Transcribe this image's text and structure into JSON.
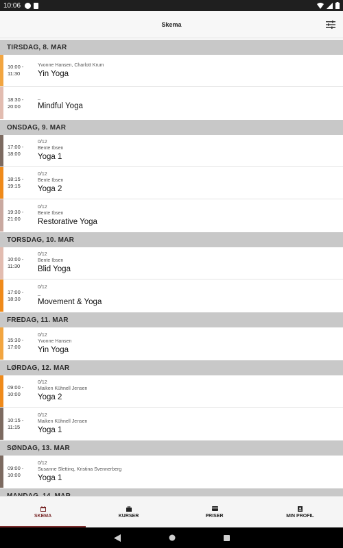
{
  "status_bar": {
    "time": "10:06"
  },
  "app_bar": {
    "title": "Skema",
    "filter_icon": "sliders-icon"
  },
  "colors": {
    "yellow": "#f2a540",
    "pink": "#e2bcb0",
    "brown": "#7c6a60",
    "orange": "#ef8a1a",
    "header": "#c8c8c8",
    "accent": "#7a2a2a"
  },
  "days": [
    {
      "header": "TIRSDAG, 8. MAR",
      "classes": [
        {
          "time_start": "10:00 -",
          "time_end": "11:30",
          "capacity": "",
          "teacher": "Yvonne Hansen, Charlott Krum",
          "name": "Yin Yoga",
          "color": "#f2a540"
        },
        {
          "time_start": "18:30 -",
          "time_end": "20:00",
          "capacity": "",
          "teacher": "_",
          "name": "Mindful Yoga",
          "color": "#e2bcb0"
        }
      ]
    },
    {
      "header": "ONSDAG, 9. MAR",
      "classes": [
        {
          "time_start": "17:00 -",
          "time_end": "18:00",
          "capacity": "0/12",
          "teacher": "Bente Ibsen",
          "name": "Yoga 1",
          "color": "#7c6a60"
        },
        {
          "time_start": "18:15 -",
          "time_end": "19:15",
          "capacity": "0/12",
          "teacher": "Bente Ibsen",
          "name": "Yoga 2",
          "color": "#ef8a1a"
        },
        {
          "time_start": "19:30 -",
          "time_end": "21:00",
          "capacity": "0/12",
          "teacher": "Bente Ibsen",
          "name": "Restorative Yoga",
          "color": "#c9a9a0"
        }
      ]
    },
    {
      "header": "TORSDAG, 10. MAR",
      "classes": [
        {
          "time_start": "10:00 -",
          "time_end": "11:30",
          "capacity": "0/12",
          "teacher": "Bente Ibsen",
          "name": "Blid Yoga",
          "color": "#e2bcb0"
        },
        {
          "time_start": "17:00 -",
          "time_end": "18:30",
          "capacity": "0/12",
          "teacher": "_",
          "name": "Movement & Yoga",
          "color": "#ef8a1a"
        }
      ]
    },
    {
      "header": "FREDAG, 11. MAR",
      "classes": [
        {
          "time_start": "15:30 -",
          "time_end": "17:00",
          "capacity": "0/12",
          "teacher": "Yvonne Hansen",
          "name": "Yin Yoga",
          "color": "#f2a540"
        }
      ]
    },
    {
      "header": "LØRDAG, 12. MAR",
      "classes": [
        {
          "time_start": "09:00 -",
          "time_end": "10:00",
          "capacity": "0/12",
          "teacher": "Maiken Kühnell Jensen",
          "name": "Yoga 2",
          "color": "#ef8a1a"
        },
        {
          "time_start": "10:15 -",
          "time_end": "11:15",
          "capacity": "0/12",
          "teacher": "Maiken Kühnell Jensen",
          "name": "Yoga 1",
          "color": "#7c6a60"
        }
      ]
    },
    {
      "header": "SØNDAG, 13. MAR",
      "classes": [
        {
          "time_start": "09:00 -",
          "time_end": "10:00",
          "capacity": "0/12",
          "teacher": "Susanne Slettinq, Kristina Svennerberg",
          "name": "Yoga 1",
          "color": "#7c6a60"
        }
      ]
    },
    {
      "header": "MANDAG, 14. MAR",
      "classes": []
    }
  ],
  "bottom_nav": [
    {
      "label": "SKEMA",
      "icon": "calendar-icon",
      "active": true
    },
    {
      "label": "KURSER",
      "icon": "briefcase-icon",
      "active": false
    },
    {
      "label": "PRISER",
      "icon": "card-icon",
      "active": false
    },
    {
      "label": "MIN PROFIL",
      "icon": "profile-icon",
      "active": false
    }
  ]
}
